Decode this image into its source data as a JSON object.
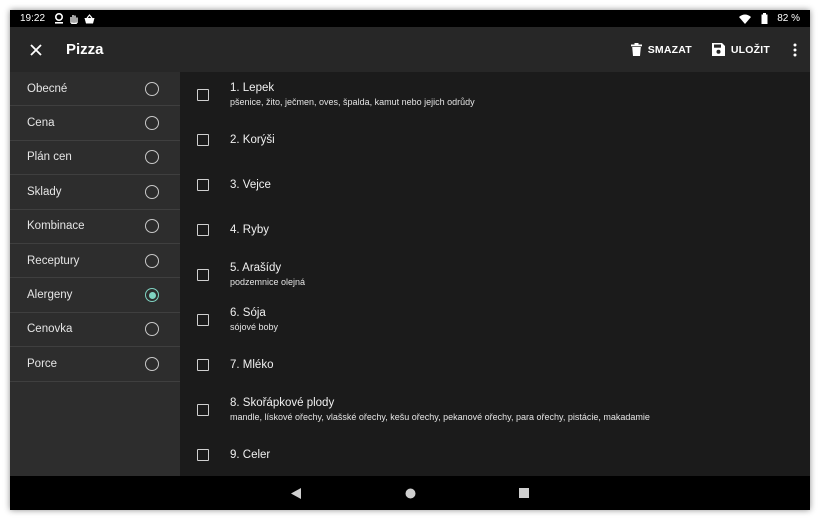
{
  "status_bar": {
    "time": "19:22",
    "battery": "82 %",
    "icons": [
      "location-icon",
      "hand-icon",
      "basket-icon",
      "wifi-icon",
      "battery-icon"
    ]
  },
  "app_bar": {
    "title": "Pizza",
    "delete_label": "SMAZAT",
    "save_label": "ULOŽIT"
  },
  "sidebar": {
    "items": [
      {
        "label": "Obecné",
        "selected": false
      },
      {
        "label": "Cena",
        "selected": false
      },
      {
        "label": "Plán cen",
        "selected": false
      },
      {
        "label": "Sklady",
        "selected": false
      },
      {
        "label": "Kombinace",
        "selected": false
      },
      {
        "label": "Receptury",
        "selected": false
      },
      {
        "label": "Alergeny",
        "selected": true
      },
      {
        "label": "Cenovka",
        "selected": false
      },
      {
        "label": "Porce",
        "selected": false
      }
    ]
  },
  "allergens": [
    {
      "name": "1. Lepek",
      "detail": "pšenice, žito, ječmen, oves, špalda, kamut nebo jejich odrůdy",
      "checked": false
    },
    {
      "name": "2. Korýši",
      "detail": "",
      "checked": false
    },
    {
      "name": "3. Vejce",
      "detail": "",
      "checked": false
    },
    {
      "name": "4. Ryby",
      "detail": "",
      "checked": false
    },
    {
      "name": "5. Arašídy",
      "detail": "podzemnice olejná",
      "checked": false
    },
    {
      "name": "6. Sója",
      "detail": "sójové boby",
      "checked": false
    },
    {
      "name": "7. Mléko",
      "detail": "",
      "checked": false
    },
    {
      "name": "8. Skořápkové plody",
      "detail": "mandle, lískové ořechy, vlašské ořechy, kešu ořechy, pekanové ořechy, para ořechy, pistácie, makadamie",
      "checked": false
    },
    {
      "name": "9. Celer",
      "detail": "",
      "checked": false
    }
  ],
  "colors": {
    "accent": "#7fd3c2",
    "app_bar": "#272727",
    "sidebar": "#2d2d2d",
    "background": "#1b1b1b"
  }
}
